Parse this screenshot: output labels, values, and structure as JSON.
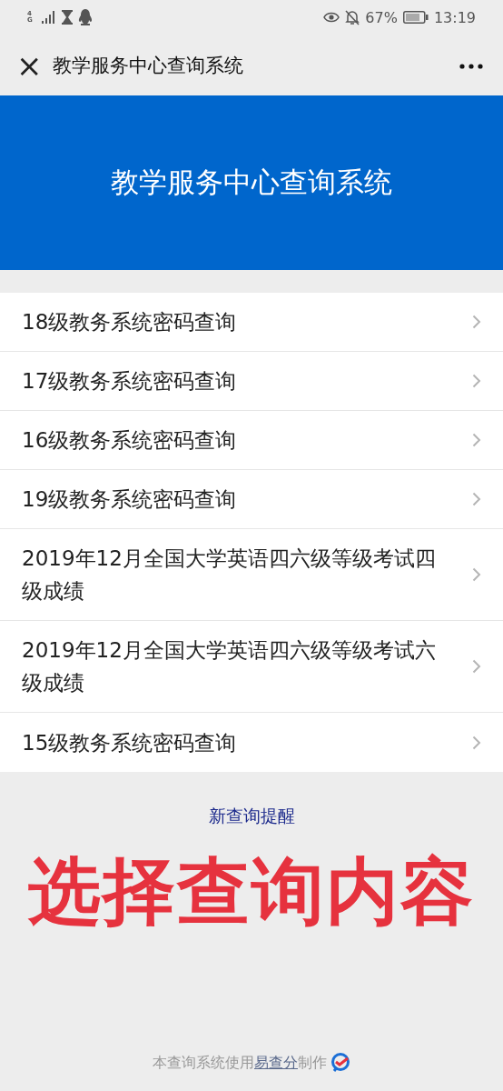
{
  "status_bar": {
    "network": "4G",
    "battery": "67%",
    "time": "13:19"
  },
  "nav": {
    "title": "教学服务中心查询系统",
    "close": "×"
  },
  "banner": {
    "title": "教学服务中心查询系统"
  },
  "items": [
    {
      "label": "18级教务系统密码查询"
    },
    {
      "label": "17级教务系统密码查询"
    },
    {
      "label": "16级教务系统密码查询"
    },
    {
      "label": "19级教务系统密码查询"
    },
    {
      "label": "2019年12月全国大学英语四六级等级考试四级成绩"
    },
    {
      "label": "2019年12月全国大学英语四六级等级考试六级成绩"
    },
    {
      "label": "15级教务系统密码查询"
    }
  ],
  "reminder_link": "新查询提醒",
  "overlay_caption": "选择查询内容",
  "footer": {
    "before": "本查询系统使用",
    "link": "易查分",
    "after": "制作"
  }
}
